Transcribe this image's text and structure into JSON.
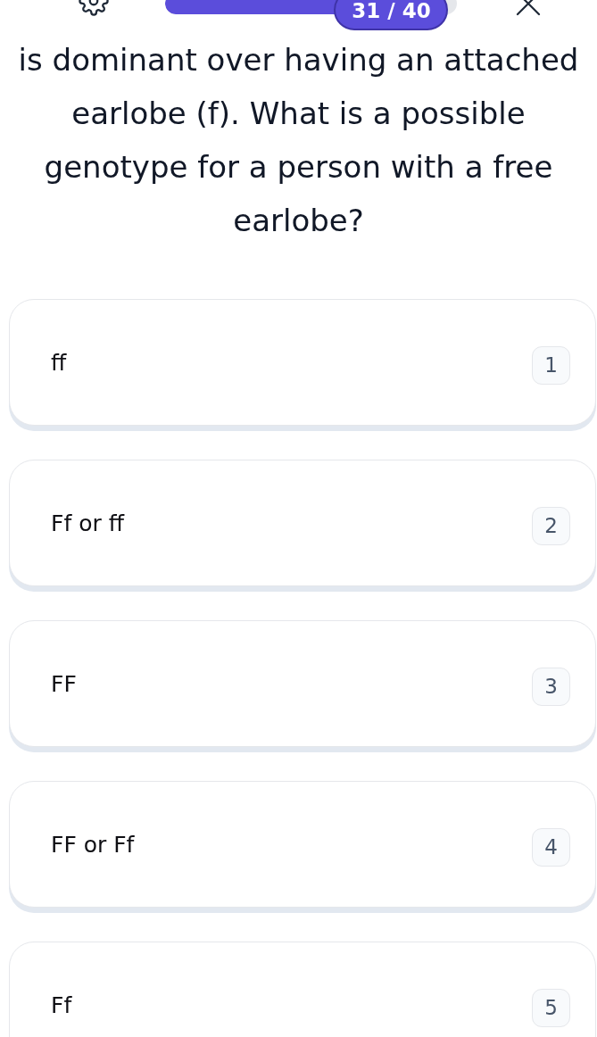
{
  "header": {
    "progress": {
      "level": 0.775,
      "counter": "31 / 40"
    }
  },
  "question": {
    "text": "is dominant over having an attached earlobe (f). What is a possible genotype for a person with a free earlobe?"
  },
  "options": [
    {
      "label": "ff",
      "key": "1",
      "selected": false
    },
    {
      "label": "Ff or ff",
      "key": "2",
      "selected": false
    },
    {
      "label": "FF",
      "key": "3",
      "selected": false
    },
    {
      "label": "FF or Ff",
      "key": "4",
      "selected": false
    },
    {
      "label": "Ff",
      "key": "5",
      "selected": false
    }
  ]
}
